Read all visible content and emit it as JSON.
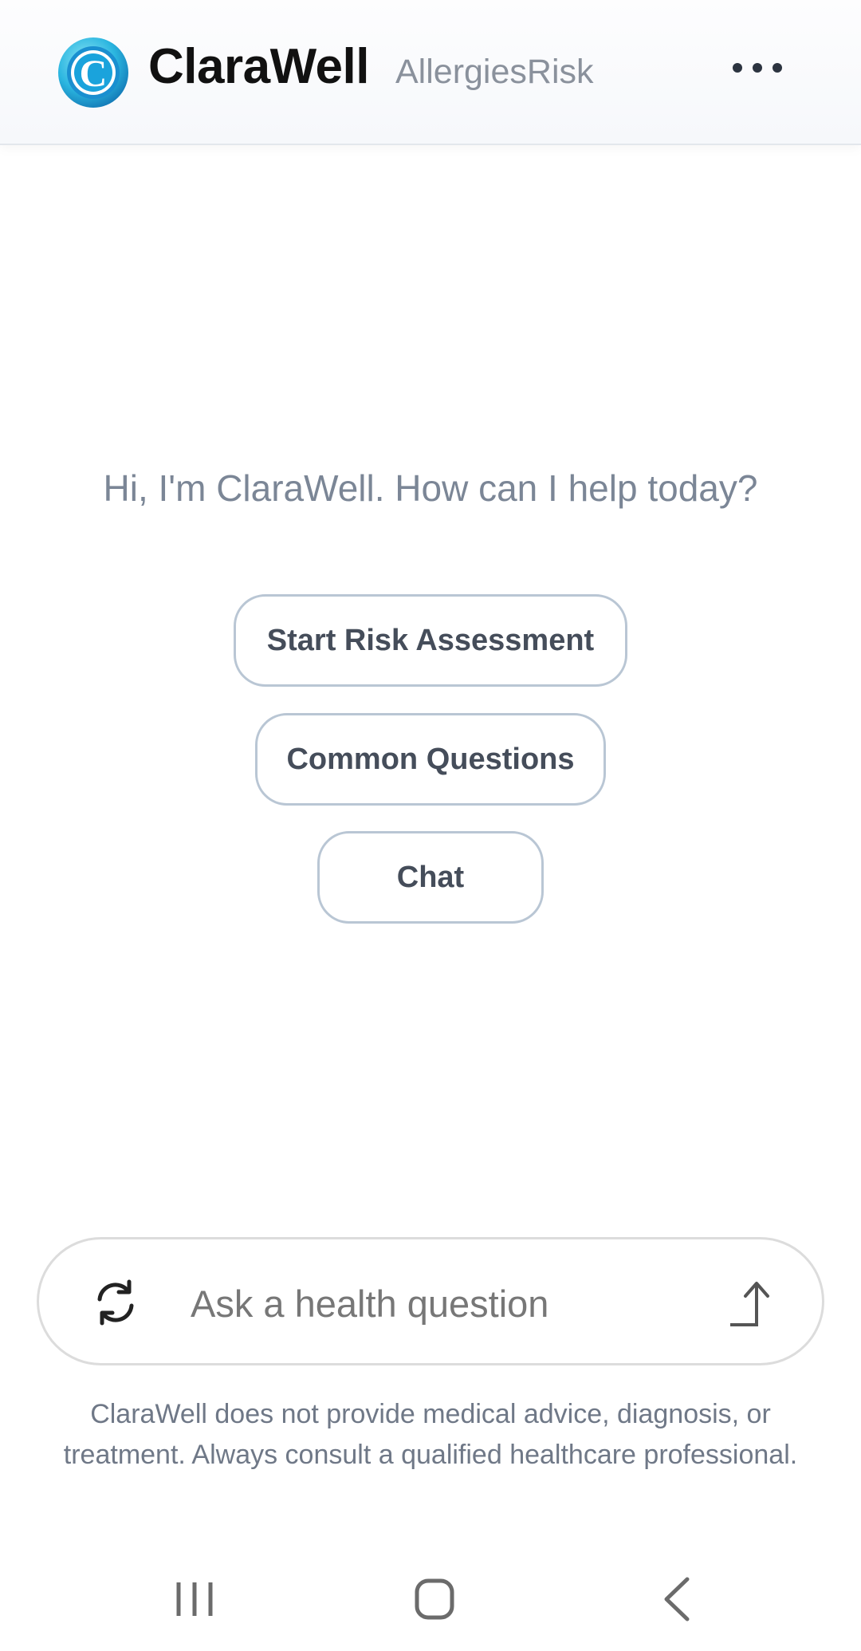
{
  "header": {
    "app_name": "ClaraWell",
    "subtitle": "AllergiesRisk",
    "logo_letter": "C",
    "icons": {
      "logo": "clarawell-logo-icon",
      "more": "more-horizontal-icon"
    }
  },
  "main": {
    "greeting": "Hi, I'm ClaraWell. How can I help today?",
    "actions": [
      {
        "label": "Start Risk Assessment"
      },
      {
        "label": "Common Questions"
      },
      {
        "label": "Chat"
      }
    ]
  },
  "composer": {
    "placeholder": "Ask a health question",
    "value": "",
    "icons": {
      "refresh": "refresh-icon",
      "send": "send-arrow-icon"
    }
  },
  "disclaimer": "ClaraWell does not provide medical advice, diagnosis, or treatment. Always consult a qualified healthcare professional.",
  "system_nav": {
    "icons": [
      "recents-icon",
      "home-icon",
      "back-icon"
    ]
  },
  "colors": {
    "accent": "#1a9fd8",
    "button_border": "#b9c6d4",
    "button_text": "#454d5a",
    "greeting_text": "#7b8696"
  }
}
